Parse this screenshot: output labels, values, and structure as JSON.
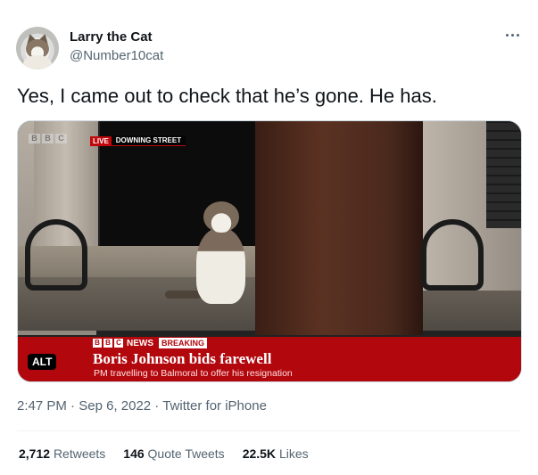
{
  "author": {
    "display_name": "Larry the Cat",
    "handle": "@Number10cat",
    "avatar_icon": "cat-avatar-icon"
  },
  "more_icon": "more-horizontal-icon",
  "tweet": {
    "text": "Yes, I came out to check that he’s gone. He has."
  },
  "media": {
    "alt_label": "ALT",
    "bbc_watermark": [
      "B",
      "B",
      "C"
    ],
    "live": {
      "badge": "LIVE",
      "location": "DOWNING STREET"
    },
    "lower_third": {
      "brand_boxes": [
        "B",
        "B",
        "C"
      ],
      "news": "NEWS",
      "breaking": "BREAKING",
      "headline": "Boris Johnson bids farewell",
      "subline": "PM travelling to Balmoral to offer his resignation"
    }
  },
  "meta": {
    "time": "2:47 PM",
    "sep1": "·",
    "date": "Sep 6, 2022",
    "sep2": "·",
    "source": "Twitter for iPhone"
  },
  "stats": {
    "retweets_count": "2,712",
    "retweets_label": "Retweets",
    "quotes_count": "146",
    "quotes_label": "Quote Tweets",
    "likes_count": "22.5K",
    "likes_label": "Likes"
  },
  "colors": {
    "text_primary": "#0f1419",
    "text_secondary": "#536471",
    "bbc_red": "#b2070d",
    "border": "#cfd9de"
  }
}
